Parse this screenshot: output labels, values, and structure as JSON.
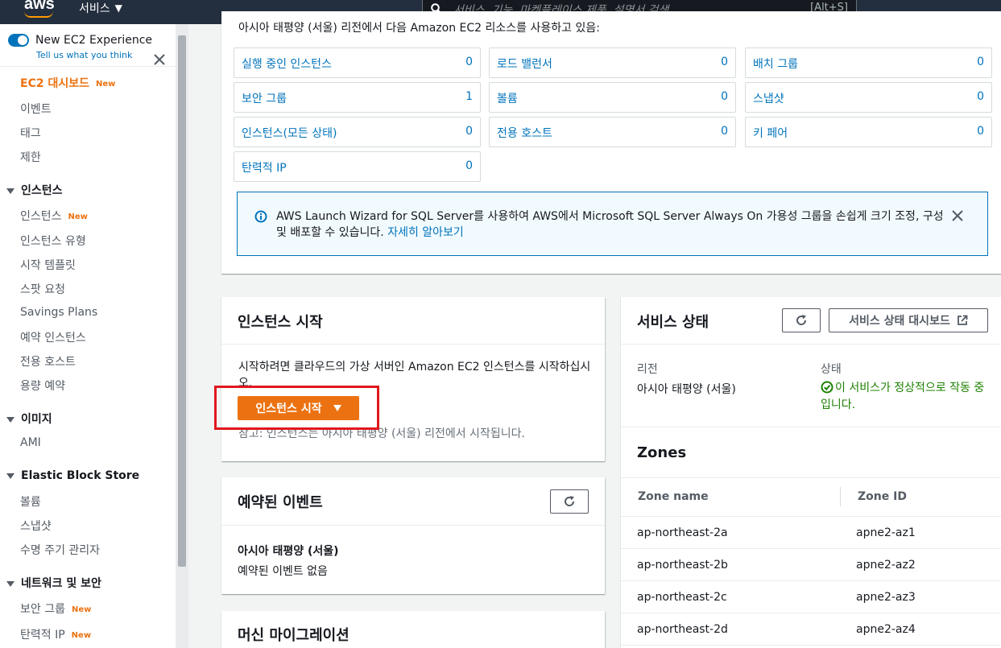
{
  "topnav": {
    "logo": "aws",
    "services_label": "서비스",
    "search_placeholder": "서비스, 기능, 마켓플레이스 제품, 설명서 검색",
    "search_shortcut": "[Alt+S]"
  },
  "sidebar": {
    "toggle_label": "New EC2 Experience",
    "toggle_sub": "Tell us what you think",
    "dashboard": "EC2 대시보드",
    "new_badge": "New",
    "top_items": [
      "이벤트",
      "태그",
      "제한"
    ],
    "groups": {
      "instances": "인스턴스",
      "images": "이미지",
      "ebs": "Elastic Block Store",
      "network": "네트워크 및 보안"
    },
    "instances_items": [
      "인스턴스",
      "인스턴스 유형",
      "시작 템플릿",
      "스팟 요청",
      "Savings Plans",
      "예약 인스턴스",
      "전용 호스트",
      "용량 예약"
    ],
    "images_items": [
      "AMI"
    ],
    "ebs_items": [
      "볼륨",
      "스냅샷",
      "수명 주기 관리자"
    ],
    "network_items": [
      "보안 그룹",
      "탄력적 IP"
    ]
  },
  "resources": {
    "intro": "아시아 태평양 (서울) 리전에서 다음 Amazon EC2 리소스를 사용하고 있음:",
    "items": [
      {
        "label": "실행 중인 인스턴스",
        "count": "0"
      },
      {
        "label": "로드 밸런서",
        "count": "0"
      },
      {
        "label": "배치 그룹",
        "count": "0"
      },
      {
        "label": "보안 그룹",
        "count": "1"
      },
      {
        "label": "볼륨",
        "count": "0"
      },
      {
        "label": "스냅샷",
        "count": "0"
      },
      {
        "label": "인스턴스(모든 상태)",
        "count": "0"
      },
      {
        "label": "전용 호스트",
        "count": "0"
      },
      {
        "label": "키 페어",
        "count": "0"
      },
      {
        "label": "탄력적 IP",
        "count": "0"
      }
    ],
    "alert_text": "AWS Launch Wizard for SQL Server를 사용하여 AWS에서 Microsoft SQL Server Always On 가용성 그룹을 손쉽게 크기 조정, 구성 및 배포할 수 있습니다.",
    "alert_link": "자세히 알아보기"
  },
  "launch": {
    "title": "인스턴스 시작",
    "desc": "시작하려면 클라우드의 가상 서버인 Amazon EC2 인스턴스를 시작하십시오.",
    "button": "인스턴스 시작",
    "note": "참고: 인스턴스는 아시아 태평양 (서울) 리전에서 시작됩니다."
  },
  "events": {
    "title": "예약된 이벤트",
    "region": "아시아 태평양 (서울)",
    "empty": "예약된 이벤트 없음"
  },
  "migration": {
    "title": "머신 마이그레이션"
  },
  "health": {
    "title": "서비스 상태",
    "dashboard_button": "서비스 상태 대시보드",
    "region_label": "리전",
    "region_value": "아시아 태평양 (서울)",
    "status_label": "상태",
    "status_value": "이 서비스가 정상적으로 작동 중입니다."
  },
  "zones": {
    "title": "Zones",
    "col_name": "Zone name",
    "col_id": "Zone ID",
    "rows": [
      {
        "name": "ap-northeast-2a",
        "id": "apne2-az1"
      },
      {
        "name": "ap-northeast-2b",
        "id": "apne2-az2"
      },
      {
        "name": "ap-northeast-2c",
        "id": "apne2-az3"
      },
      {
        "name": "ap-northeast-2d",
        "id": "apne2-az4"
      }
    ]
  },
  "colors": {
    "nav_bg": "#232f3e",
    "accent_orange": "#ec7211",
    "link_blue": "#0073bb",
    "success_green": "#1d8102",
    "highlight_red": "#e0181d"
  }
}
